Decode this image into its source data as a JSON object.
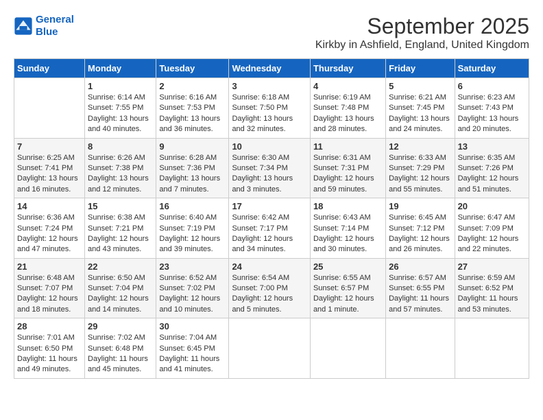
{
  "logo": {
    "line1": "General",
    "line2": "Blue"
  },
  "title": "September 2025",
  "subtitle": "Kirkby in Ashfield, England, United Kingdom",
  "headers": [
    "Sunday",
    "Monday",
    "Tuesday",
    "Wednesday",
    "Thursday",
    "Friday",
    "Saturday"
  ],
  "weeks": [
    [
      {
        "day": "",
        "sunrise": "",
        "sunset": "",
        "daylight": ""
      },
      {
        "day": "1",
        "sunrise": "Sunrise: 6:14 AM",
        "sunset": "Sunset: 7:55 PM",
        "daylight": "Daylight: 13 hours and 40 minutes."
      },
      {
        "day": "2",
        "sunrise": "Sunrise: 6:16 AM",
        "sunset": "Sunset: 7:53 PM",
        "daylight": "Daylight: 13 hours and 36 minutes."
      },
      {
        "day": "3",
        "sunrise": "Sunrise: 6:18 AM",
        "sunset": "Sunset: 7:50 PM",
        "daylight": "Daylight: 13 hours and 32 minutes."
      },
      {
        "day": "4",
        "sunrise": "Sunrise: 6:19 AM",
        "sunset": "Sunset: 7:48 PM",
        "daylight": "Daylight: 13 hours and 28 minutes."
      },
      {
        "day": "5",
        "sunrise": "Sunrise: 6:21 AM",
        "sunset": "Sunset: 7:45 PM",
        "daylight": "Daylight: 13 hours and 24 minutes."
      },
      {
        "day": "6",
        "sunrise": "Sunrise: 6:23 AM",
        "sunset": "Sunset: 7:43 PM",
        "daylight": "Daylight: 13 hours and 20 minutes."
      }
    ],
    [
      {
        "day": "7",
        "sunrise": "Sunrise: 6:25 AM",
        "sunset": "Sunset: 7:41 PM",
        "daylight": "Daylight: 13 hours and 16 minutes."
      },
      {
        "day": "8",
        "sunrise": "Sunrise: 6:26 AM",
        "sunset": "Sunset: 7:38 PM",
        "daylight": "Daylight: 13 hours and 12 minutes."
      },
      {
        "day": "9",
        "sunrise": "Sunrise: 6:28 AM",
        "sunset": "Sunset: 7:36 PM",
        "daylight": "Daylight: 13 hours and 7 minutes."
      },
      {
        "day": "10",
        "sunrise": "Sunrise: 6:30 AM",
        "sunset": "Sunset: 7:34 PM",
        "daylight": "Daylight: 13 hours and 3 minutes."
      },
      {
        "day": "11",
        "sunrise": "Sunrise: 6:31 AM",
        "sunset": "Sunset: 7:31 PM",
        "daylight": "Daylight: 12 hours and 59 minutes."
      },
      {
        "day": "12",
        "sunrise": "Sunrise: 6:33 AM",
        "sunset": "Sunset: 7:29 PM",
        "daylight": "Daylight: 12 hours and 55 minutes."
      },
      {
        "day": "13",
        "sunrise": "Sunrise: 6:35 AM",
        "sunset": "Sunset: 7:26 PM",
        "daylight": "Daylight: 12 hours and 51 minutes."
      }
    ],
    [
      {
        "day": "14",
        "sunrise": "Sunrise: 6:36 AM",
        "sunset": "Sunset: 7:24 PM",
        "daylight": "Daylight: 12 hours and 47 minutes."
      },
      {
        "day": "15",
        "sunrise": "Sunrise: 6:38 AM",
        "sunset": "Sunset: 7:21 PM",
        "daylight": "Daylight: 12 hours and 43 minutes."
      },
      {
        "day": "16",
        "sunrise": "Sunrise: 6:40 AM",
        "sunset": "Sunset: 7:19 PM",
        "daylight": "Daylight: 12 hours and 39 minutes."
      },
      {
        "day": "17",
        "sunrise": "Sunrise: 6:42 AM",
        "sunset": "Sunset: 7:17 PM",
        "daylight": "Daylight: 12 hours and 34 minutes."
      },
      {
        "day": "18",
        "sunrise": "Sunrise: 6:43 AM",
        "sunset": "Sunset: 7:14 PM",
        "daylight": "Daylight: 12 hours and 30 minutes."
      },
      {
        "day": "19",
        "sunrise": "Sunrise: 6:45 AM",
        "sunset": "Sunset: 7:12 PM",
        "daylight": "Daylight: 12 hours and 26 minutes."
      },
      {
        "day": "20",
        "sunrise": "Sunrise: 6:47 AM",
        "sunset": "Sunset: 7:09 PM",
        "daylight": "Daylight: 12 hours and 22 minutes."
      }
    ],
    [
      {
        "day": "21",
        "sunrise": "Sunrise: 6:48 AM",
        "sunset": "Sunset: 7:07 PM",
        "daylight": "Daylight: 12 hours and 18 minutes."
      },
      {
        "day": "22",
        "sunrise": "Sunrise: 6:50 AM",
        "sunset": "Sunset: 7:04 PM",
        "daylight": "Daylight: 12 hours and 14 minutes."
      },
      {
        "day": "23",
        "sunrise": "Sunrise: 6:52 AM",
        "sunset": "Sunset: 7:02 PM",
        "daylight": "Daylight: 12 hours and 10 minutes."
      },
      {
        "day": "24",
        "sunrise": "Sunrise: 6:54 AM",
        "sunset": "Sunset: 7:00 PM",
        "daylight": "Daylight: 12 hours and 5 minutes."
      },
      {
        "day": "25",
        "sunrise": "Sunrise: 6:55 AM",
        "sunset": "Sunset: 6:57 PM",
        "daylight": "Daylight: 12 hours and 1 minute."
      },
      {
        "day": "26",
        "sunrise": "Sunrise: 6:57 AM",
        "sunset": "Sunset: 6:55 PM",
        "daylight": "Daylight: 11 hours and 57 minutes."
      },
      {
        "day": "27",
        "sunrise": "Sunrise: 6:59 AM",
        "sunset": "Sunset: 6:52 PM",
        "daylight": "Daylight: 11 hours and 53 minutes."
      }
    ],
    [
      {
        "day": "28",
        "sunrise": "Sunrise: 7:01 AM",
        "sunset": "Sunset: 6:50 PM",
        "daylight": "Daylight: 11 hours and 49 minutes."
      },
      {
        "day": "29",
        "sunrise": "Sunrise: 7:02 AM",
        "sunset": "Sunset: 6:48 PM",
        "daylight": "Daylight: 11 hours and 45 minutes."
      },
      {
        "day": "30",
        "sunrise": "Sunrise: 7:04 AM",
        "sunset": "Sunset: 6:45 PM",
        "daylight": "Daylight: 11 hours and 41 minutes."
      },
      {
        "day": "",
        "sunrise": "",
        "sunset": "",
        "daylight": ""
      },
      {
        "day": "",
        "sunrise": "",
        "sunset": "",
        "daylight": ""
      },
      {
        "day": "",
        "sunrise": "",
        "sunset": "",
        "daylight": ""
      },
      {
        "day": "",
        "sunrise": "",
        "sunset": "",
        "daylight": ""
      }
    ]
  ]
}
